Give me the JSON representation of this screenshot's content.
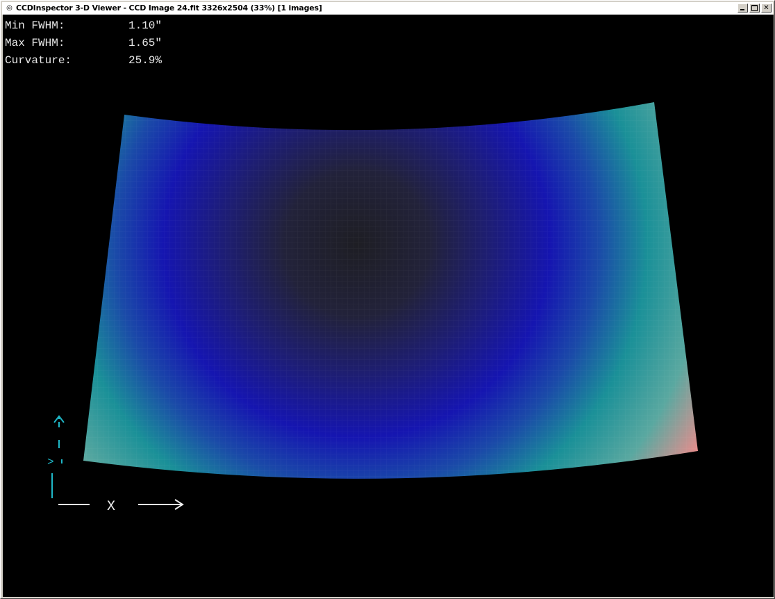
{
  "window": {
    "title": "CCDInspector 3-D Viewer - CCD Image 24.fit 3326x2504 (33%)  [1 images]",
    "app_icon": "ccdinspector-app-icon"
  },
  "title_buttons": {
    "minimize_icon": "minimize-icon",
    "maximize_icon": "maximize-icon",
    "close_icon": "close-icon"
  },
  "stats": {
    "min_fwhm_label": "Min FWHM:",
    "min_fwhm_value": "1.10\"",
    "max_fwhm_label": "Max FWHM:",
    "max_fwhm_value": "1.65\"",
    "curvature_label": "Curvature:",
    "curvature_value": "25.9%"
  },
  "axes": {
    "x_label": "X",
    "y_arrow_icon": "y-axis-arrow-icon",
    "z_marker": ">"
  },
  "colors": {
    "background": "#000000",
    "surface_center": "#1f1f2a",
    "surface_mid": "#1c1caa",
    "surface_edge": "#1f8f9a",
    "surface_corner": "#f08888",
    "axis_color": "#1fb8c8"
  }
}
